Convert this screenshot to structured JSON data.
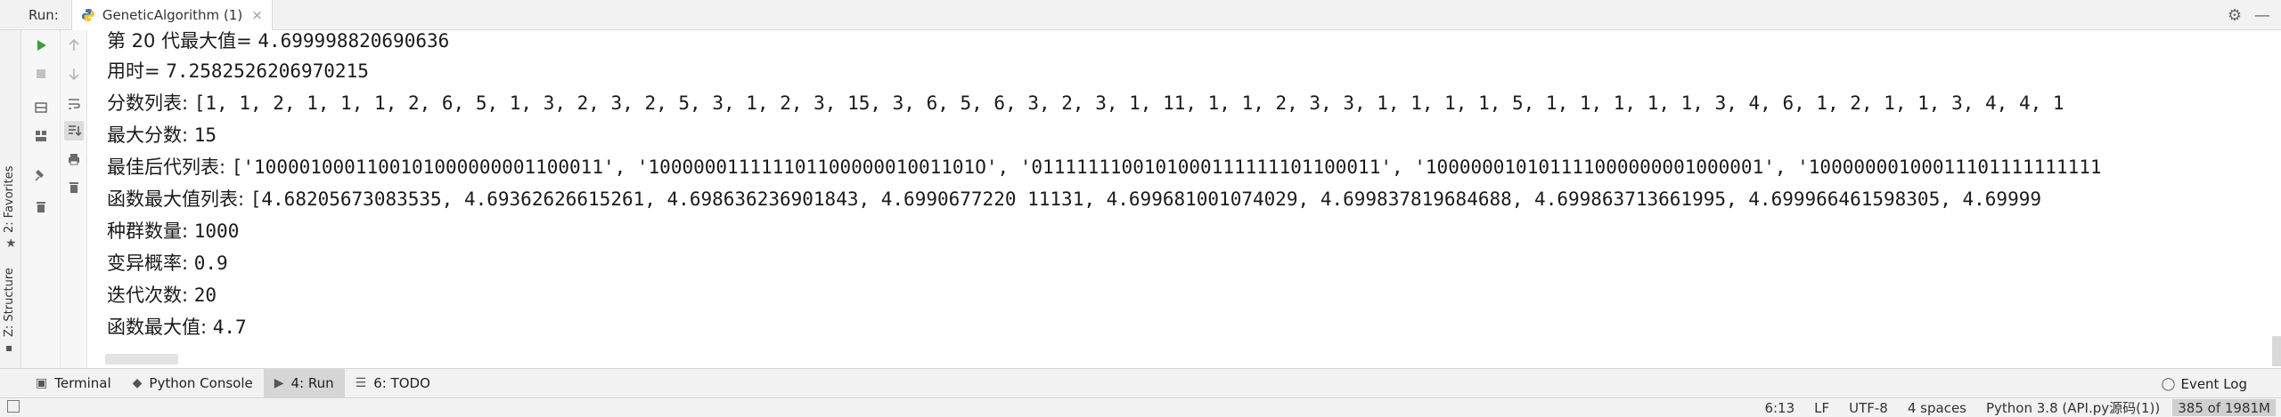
{
  "runbar": {
    "label": "Run:",
    "tab_title": "GeneticAlgorithm (1)",
    "tab_close": "×",
    "gear": "⚙",
    "minimize": "—"
  },
  "left_strip": {
    "favorites": "2: Favorites",
    "structure": "Z: Structure"
  },
  "console": {
    "lines": [
      {
        "label": "第 20 代最大值= ",
        "value": "4.699998820690636"
      },
      {
        "label": "用时= ",
        "value": "7.2582526206970215"
      },
      {
        "label": "分数列表: ",
        "value": "[1, 1, 2, 1, 1, 1, 2, 6, 5, 1, 3, 2, 3, 2, 5, 3, 1, 2, 3, 15, 3, 6, 5, 6, 3, 2, 3, 1, 11, 1, 1, 2, 3, 3, 1, 1, 1, 1, 5, 1, 1, 1, 1, 1, 3, 4, 6, 1, 2, 1, 1, 3, 4, 4, 1"
      },
      {
        "label": "最大分数: ",
        "value": "15"
      },
      {
        "label": "最佳后代列表: ",
        "value": "['1000010001100101000000001100011', '10000001111110110000001001101O', '0111111100101000111111101100011', '100000010101111000000001000001', '10000000100011101111111111"
      },
      {
        "label": "函数最大值列表: ",
        "value": "[4.68205673083535, 4.69362626615261, 4.698636236901843, 4.6990677220 11131, 4.699681001074029, 4.699837819684688, 4.699863713661995, 4.699966461598305, 4.69999"
      },
      {
        "label": "种群数量: ",
        "value": "1000"
      },
      {
        "label": "变异概率: ",
        "value": "0.9"
      },
      {
        "label": "迭代次数: ",
        "value": "20"
      },
      {
        "label": "函数最大值: ",
        "value": "4.7"
      }
    ]
  },
  "bottom_tabs": [
    {
      "icon": "terminal-icon",
      "label": "Terminal"
    },
    {
      "icon": "python-console-icon",
      "label": "Python Console"
    },
    {
      "icon": "run-icon",
      "label": "4: Run"
    },
    {
      "icon": "todo-icon",
      "label": "6: TODO"
    }
  ],
  "event_log": "Event Log",
  "status": {
    "position": "6:13",
    "line_sep": "LF",
    "encoding": "UTF-8",
    "indent": "4 spaces",
    "interpreter": "Python 3.8 (API.py源码(1))",
    "memory": "385 of 1981M"
  }
}
